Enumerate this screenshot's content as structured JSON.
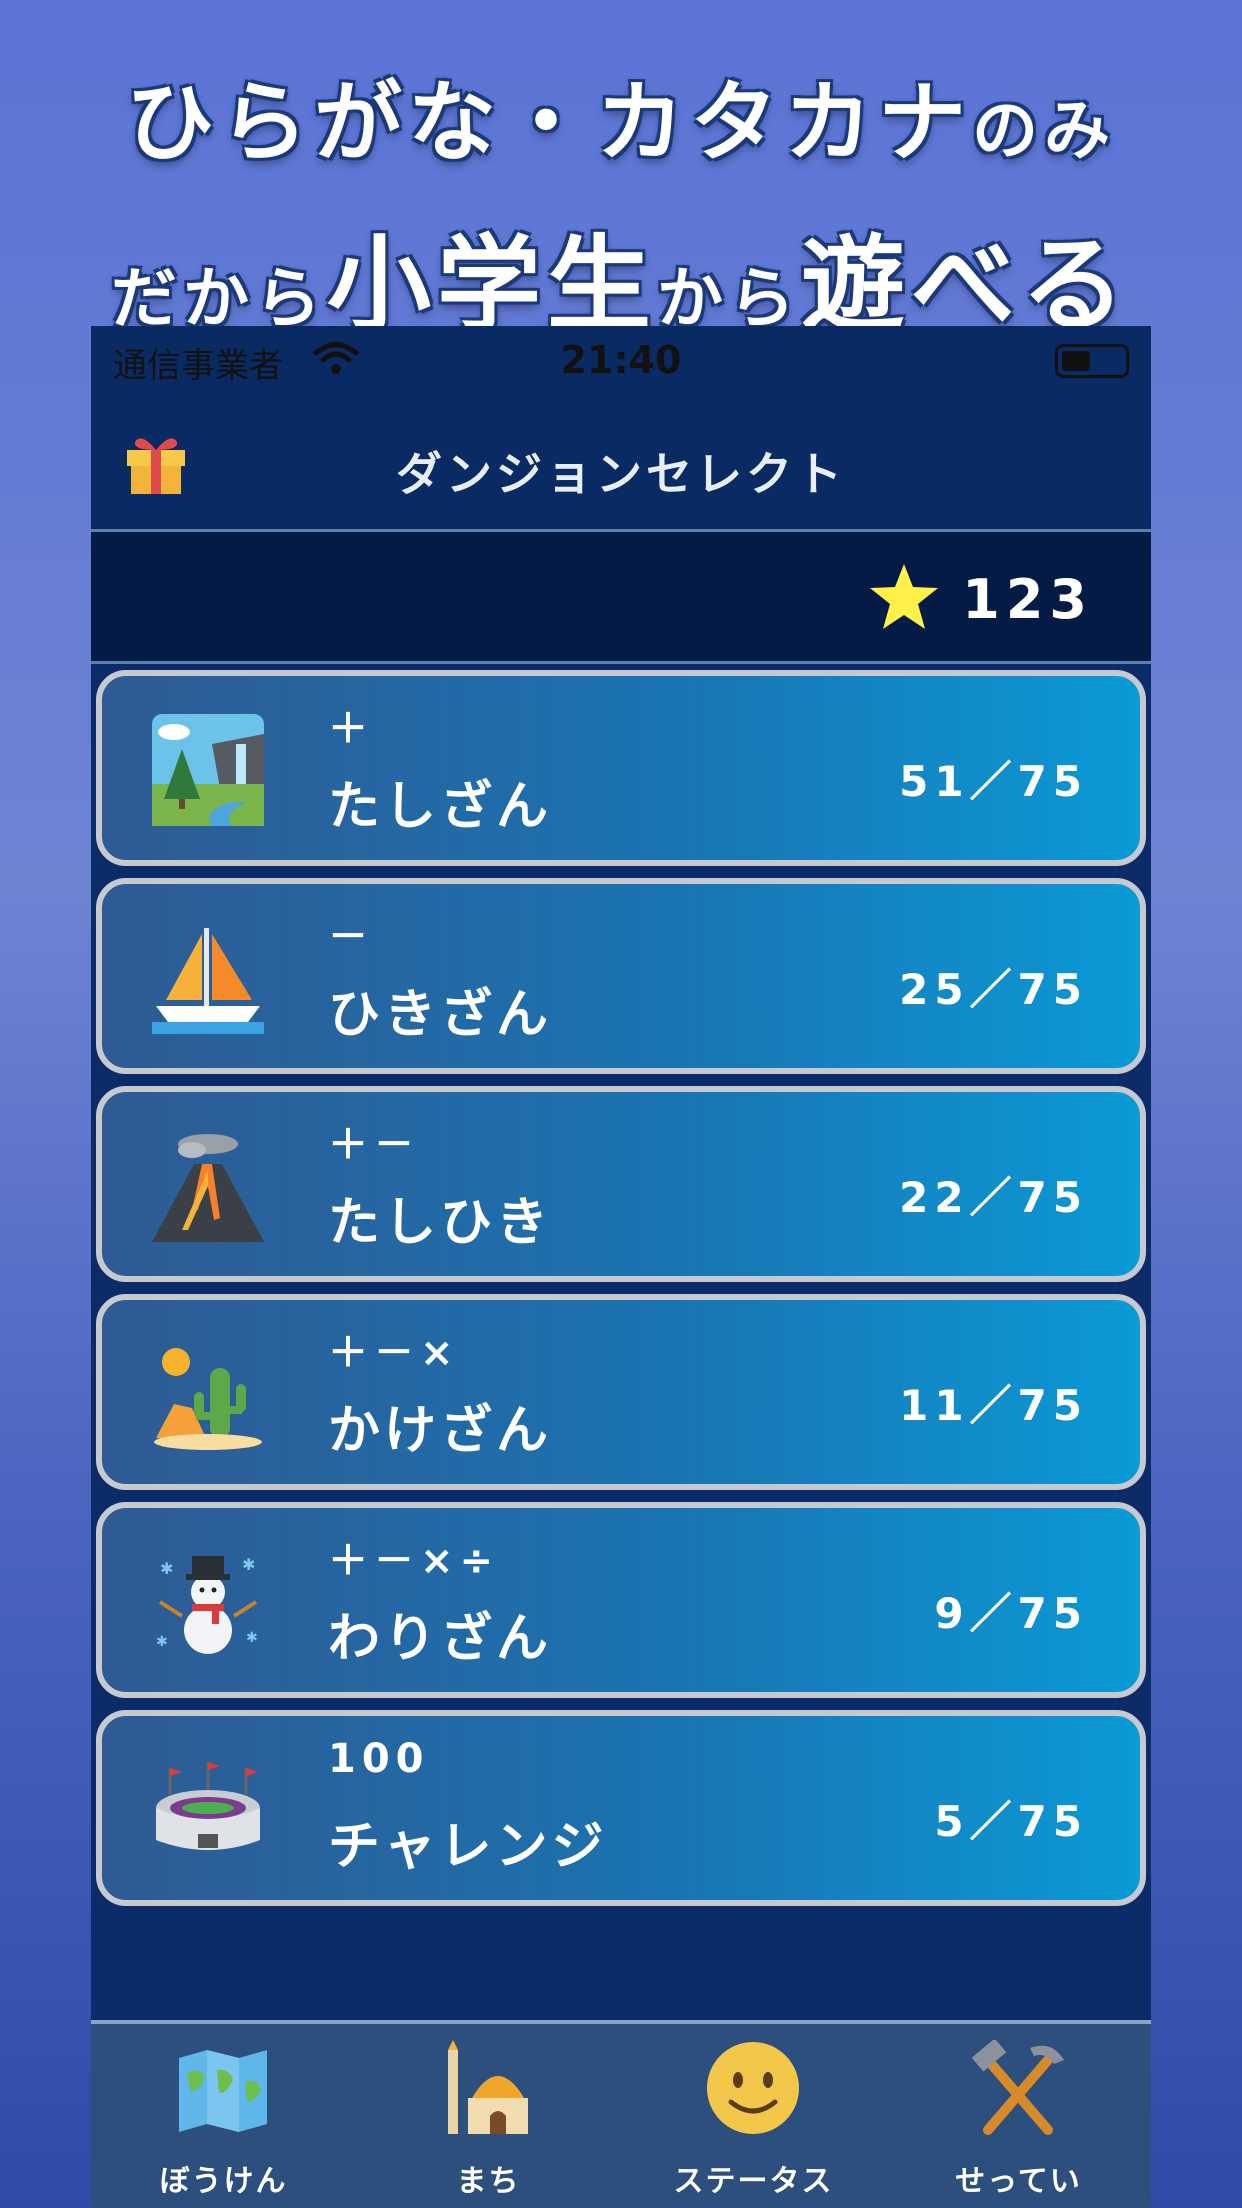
{
  "headline": {
    "line1_main": "ひらがな・カタカナ",
    "line1_tail": "のみ",
    "line2_a": "だから",
    "line2_b": "小学生",
    "line2_c": "から",
    "line2_d": "遊べる"
  },
  "status_bar": {
    "carrier": "通信事業者",
    "time": "21:40"
  },
  "nav": {
    "title": "ダンジョンセレクト",
    "left_icon": "gift-icon"
  },
  "stars": {
    "icon": "star-icon",
    "count": "123"
  },
  "dungeons": [
    {
      "icon": "waterfall-landscape-icon",
      "ops": "＋",
      "name": "たしざん",
      "progress": "51／75"
    },
    {
      "icon": "sailboat-icon",
      "ops": "－",
      "name": "ひきざん",
      "progress": "25／75"
    },
    {
      "icon": "volcano-icon",
      "ops": "＋－",
      "name": "たしひき",
      "progress": "22／75"
    },
    {
      "icon": "desert-cactus-icon",
      "ops": "＋－×",
      "name": "かけざん",
      "progress": "11／75"
    },
    {
      "icon": "snowman-icon",
      "ops": "＋－×÷",
      "name": "わりざん",
      "progress": "9／75"
    },
    {
      "icon": "stadium-icon",
      "ops": "100",
      "name": "チャレンジ",
      "progress": "5／75"
    }
  ],
  "tabs": [
    {
      "icon": "world-map-icon",
      "label": "ぼうけん"
    },
    {
      "icon": "mosque-town-icon",
      "label": "まち"
    },
    {
      "icon": "smiley-face-icon",
      "label": "ステータス"
    },
    {
      "icon": "hammer-pick-icon",
      "label": "せってい"
    }
  ],
  "colors": {
    "background_top": "#5b74d6",
    "phone_bg": "#0b2c69",
    "card_gradient_left": "#2f5a93",
    "card_gradient_right": "#0a9ad6",
    "star": "#fff04a"
  }
}
